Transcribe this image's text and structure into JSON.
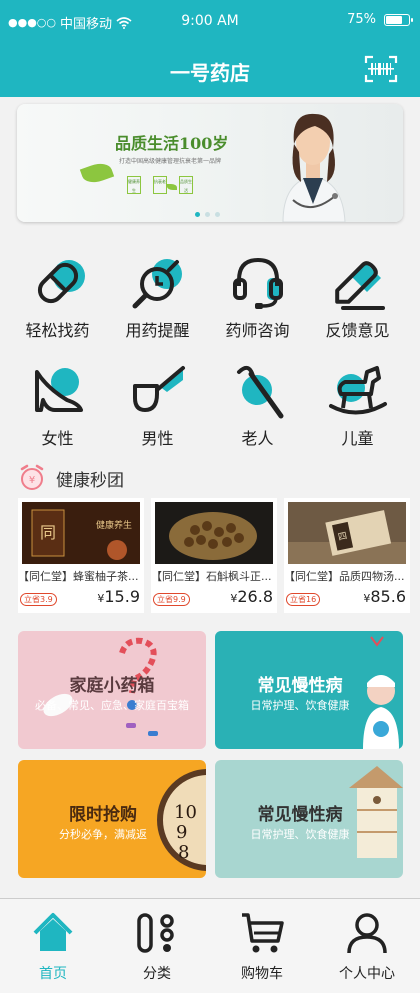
{
  "status_bar": {
    "carrier": "中国移动",
    "signal": "●●●○○",
    "time": "9:00 AM",
    "battery": "75%",
    "battery_level": 0.75
  },
  "header": {
    "title": "一号药店",
    "scan_icon": "scan-icon"
  },
  "banner": {
    "headline": "品质生活100岁",
    "subline": "打造中国高级健康管理抗衰老第一品牌",
    "tags": [
      "健康养生",
      "抗衰老",
      "品质生活"
    ],
    "pages": 3,
    "active_page": 1
  },
  "categories": [
    {
      "label": "轻松找药",
      "icon": "capsule-icon"
    },
    {
      "label": "用药提醒",
      "icon": "alarm-clock-icon"
    },
    {
      "label": "药师咨询",
      "icon": "headset-icon"
    },
    {
      "label": "反馈意见",
      "icon": "pencil-icon"
    },
    {
      "label": "女性",
      "icon": "high-heel-icon"
    },
    {
      "label": "男性",
      "icon": "pipe-icon"
    },
    {
      "label": "老人",
      "icon": "walking-cane-icon"
    },
    {
      "label": "儿童",
      "icon": "rocking-horse-icon"
    }
  ],
  "flash_sale": {
    "title": "健康秒团",
    "icon": "alarm-clock-icon",
    "products": [
      {
        "name": "【同仁堂】蜂蜜柚子茶...",
        "badge": "立省3.9",
        "currency": "¥",
        "price": "15.9"
      },
      {
        "name": "【同仁堂】石斛枫斗正...",
        "badge": "立省9.9",
        "currency": "¥",
        "price": "26.8"
      },
      {
        "name": "【同仁堂】品质四物汤...",
        "badge": "立省16",
        "currency": "¥",
        "price": "85.6"
      }
    ]
  },
  "promo_cards": [
    {
      "title": "家庭小药箱",
      "subtitle": "必备、常见、应急、家庭百宝箱",
      "color": "#f1c9d0"
    },
    {
      "title": "常见慢性病",
      "subtitle": "日常护理、饮食健康",
      "color": "#2ab1b5"
    },
    {
      "title": "限时抢购",
      "subtitle": "分秒必争，满减返",
      "color": "#f6a623"
    },
    {
      "title": "常见慢性病",
      "subtitle": "日常护理、饮食健康",
      "color": "#a8d6d0"
    }
  ],
  "tab_bar": [
    {
      "label": "首页",
      "icon": "home-icon",
      "active": true
    },
    {
      "label": "分类",
      "icon": "category-icon",
      "active": false
    },
    {
      "label": "购物车",
      "icon": "cart-icon",
      "active": false
    },
    {
      "label": "个人中心",
      "icon": "person-icon",
      "active": false
    }
  ],
  "colors": {
    "accent": "#1fb6c1",
    "dark": "#222222",
    "price_tag": "#e0482c"
  }
}
